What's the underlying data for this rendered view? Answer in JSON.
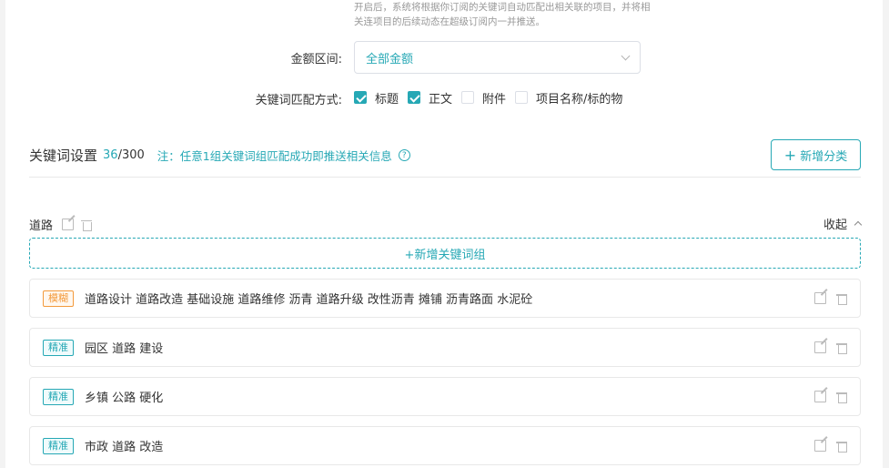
{
  "settings": {
    "hint": "开启后，系统将根据你订阅的关键词自动匹配出相关联的项目，并将相关连项目的后续动态在超级订阅内一并推送。",
    "amount_label": "金额区间:",
    "amount_value": "全部金额",
    "match_label": "关键词匹配方式:",
    "match_options": [
      {
        "label": "标题",
        "checked": true
      },
      {
        "label": "正文",
        "checked": true
      },
      {
        "label": "附件",
        "checked": false
      },
      {
        "label": "项目名称/标的物",
        "checked": false
      }
    ]
  },
  "keywords": {
    "title": "关键词设置",
    "used": "36",
    "total": "/300",
    "note": "注：任意1组关键词组匹配成功即推送相关信息",
    "help_glyph": "?",
    "add_category_label": "新增分类"
  },
  "category": {
    "name": "道路",
    "collapse_label": "收起",
    "add_group_label": "+新增关键词组",
    "groups": [
      {
        "tag": "模糊",
        "type": "fuzzy",
        "keywords": "道路设计 道路改造 基础设施 道路维修 沥青 道路升级 改性沥青 摊铺 沥青路面 水泥砼"
      },
      {
        "tag": "精准",
        "type": "exact",
        "keywords": "园区 道路 建设"
      },
      {
        "tag": "精准",
        "type": "exact",
        "keywords": "乡镇 公路 硬化"
      },
      {
        "tag": "精准",
        "type": "exact",
        "keywords": "市政 道路 改造"
      }
    ]
  },
  "colors": {
    "accent": "#26a8b5",
    "fuzzy": "#f39a3c"
  },
  "icons": {
    "edit": "edit-icon",
    "delete": "trash-icon",
    "collapse": "chevron-up-icon",
    "select": "chevron-down-icon",
    "help": "help-circle-icon"
  }
}
